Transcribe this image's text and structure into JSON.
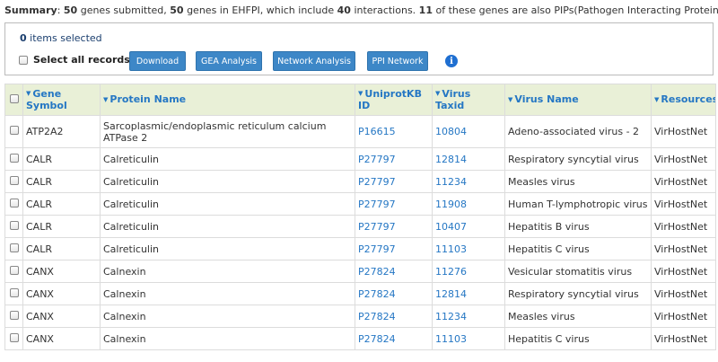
{
  "summary": {
    "label": "Summary",
    "genes_submitted": "50",
    "genes_in_db": "50",
    "interactions": "40",
    "pip_genes": "11",
    "t1": ": ",
    "t2": " genes submitted, ",
    "t3": " genes in EHFPI, which include ",
    "t4": " interactions. ",
    "t5": " of these genes are also PIPs(Pathogen Interacting Proteins)."
  },
  "selection": {
    "count": "0",
    "suffix": " items selected",
    "select_all_label": "Select all records"
  },
  "buttons": {
    "download": "Download",
    "gea": "GEA Analysis",
    "network": "Network Analysis",
    "ppi": "PPI Network"
  },
  "info_icon": "i",
  "colors": {
    "accent": "#2577c4",
    "button": "#3d87c7",
    "header_bg": "#e9f0d7"
  },
  "table": {
    "sort_icon": "▼",
    "headers": [
      "Gene Symbol",
      "Protein Name",
      "UniprotKB ID",
      "Virus Taxid",
      "Virus Name",
      "Resources"
    ],
    "rows": [
      {
        "gene": "ATP2A2",
        "protein": "Sarcoplasmic/endoplasmic reticulum calcium ATPase 2",
        "uniprot": "P16615",
        "taxid": "10804",
        "virus": "Adeno-associated virus - 2",
        "resource": "VirHostNet"
      },
      {
        "gene": "CALR",
        "protein": "Calreticulin",
        "uniprot": "P27797",
        "taxid": "12814",
        "virus": "Respiratory syncytial virus",
        "resource": "VirHostNet"
      },
      {
        "gene": "CALR",
        "protein": "Calreticulin",
        "uniprot": "P27797",
        "taxid": "11234",
        "virus": "Measles virus",
        "resource": "VirHostNet"
      },
      {
        "gene": "CALR",
        "protein": "Calreticulin",
        "uniprot": "P27797",
        "taxid": "11908",
        "virus": "Human T-lymphotropic virus 1",
        "resource": "VirHostNet"
      },
      {
        "gene": "CALR",
        "protein": "Calreticulin",
        "uniprot": "P27797",
        "taxid": "10407",
        "virus": "Hepatitis B virus",
        "resource": "VirHostNet"
      },
      {
        "gene": "CALR",
        "protein": "Calreticulin",
        "uniprot": "P27797",
        "taxid": "11103",
        "virus": "Hepatitis C virus",
        "resource": "VirHostNet"
      },
      {
        "gene": "CANX",
        "protein": "Calnexin",
        "uniprot": "P27824",
        "taxid": "11276",
        "virus": "Vesicular stomatitis virus",
        "resource": "VirHostNet"
      },
      {
        "gene": "CANX",
        "protein": "Calnexin",
        "uniprot": "P27824",
        "taxid": "12814",
        "virus": "Respiratory syncytial virus",
        "resource": "VirHostNet"
      },
      {
        "gene": "CANX",
        "protein": "Calnexin",
        "uniprot": "P27824",
        "taxid": "11234",
        "virus": "Measles virus",
        "resource": "VirHostNet"
      },
      {
        "gene": "CANX",
        "protein": "Calnexin",
        "uniprot": "P27824",
        "taxid": "11103",
        "virus": "Hepatitis C virus",
        "resource": "VirHostNet"
      }
    ]
  }
}
